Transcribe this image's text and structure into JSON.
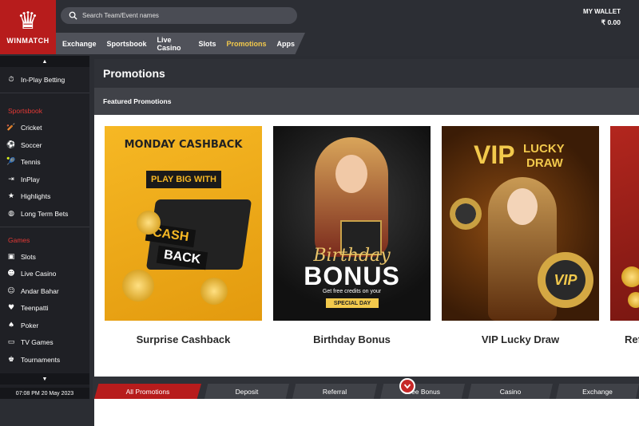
{
  "brand": {
    "name": "WINMATCH"
  },
  "search": {
    "placeholder": "Search Team/Event names"
  },
  "nav": [
    {
      "label": "Exchange",
      "active": false
    },
    {
      "label": "Sportsbook",
      "active": false
    },
    {
      "label": "Live Casino",
      "active": false
    },
    {
      "label": "Slots",
      "active": false
    },
    {
      "label": "Promotions",
      "active": true
    },
    {
      "label": "Apps",
      "active": false
    }
  ],
  "wallet": {
    "label": "MY WALLET",
    "amount": "₹ 0.00"
  },
  "sidebar": {
    "inplay_betting": "In-Play Betting",
    "sportsbook_title": "Sportsbook",
    "sports": [
      "Cricket",
      "Soccer",
      "Tennis",
      "InPlay",
      "Highlights",
      "Long Term Bets"
    ],
    "games_title": "Games",
    "games": [
      "Slots",
      "Live Casino",
      "Andar Bahar",
      "Teenpatti",
      "Poker",
      "TV Games",
      "Tournaments"
    ],
    "clock": "07:08 PM  20 May 2023"
  },
  "main": {
    "title": "Promotions",
    "featured_title": "Featured Promotions",
    "cards": [
      {
        "caption": "Surprise Cashback",
        "art_lines": [
          "MONDAY CASHBACK",
          "PLAY BIG WITH",
          "CASH",
          "BACK"
        ]
      },
      {
        "caption": "Birthday Bonus",
        "art_lines": [
          "Birthday",
          "BONUS",
          "Get free credits on your",
          "SPECIAL DAY"
        ]
      },
      {
        "caption": "VIP Lucky Draw",
        "art_lines": [
          "VIP",
          "LUCKY",
          "DRAW",
          "VIP"
        ]
      },
      {
        "caption": "Ref"
      }
    ],
    "tabs": [
      {
        "label": "All Promotions",
        "active": true
      },
      {
        "label": "Deposit",
        "active": false
      },
      {
        "label": "Referral",
        "active": false
      },
      {
        "label": "Free Bonus",
        "active": false
      },
      {
        "label": "Casino",
        "active": false
      },
      {
        "label": "Exchange",
        "active": false
      }
    ]
  },
  "colors": {
    "brand_red": "#b71c1c",
    "active_nav": "#f2c94c",
    "section_red": "#e53935"
  },
  "icons": {
    "search": "search-icon",
    "inplay": "stopwatch-icon",
    "cricket": "cricket-icon",
    "soccer": "soccer-ball-icon",
    "tennis": "tennis-icon",
    "inplay_sport": "inplay-icon",
    "highlights": "star-icon",
    "long_term": "globe-icon",
    "slots": "slot-machine-icon",
    "live_casino": "dealer-icon",
    "andar_bahar": "user-icon",
    "teenpatti": "cards-icon",
    "poker": "poker-icon",
    "tv_games": "tv-icon",
    "tournaments": "trophy-icon"
  }
}
